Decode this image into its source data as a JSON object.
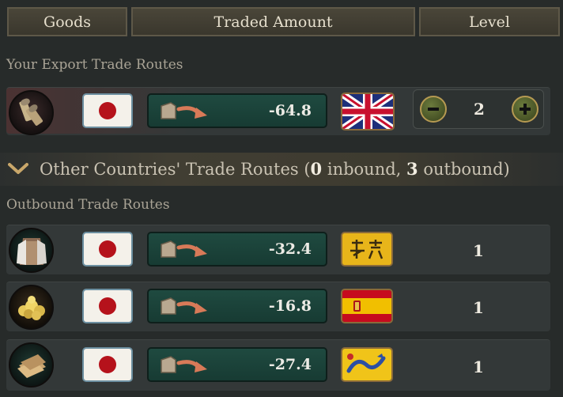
{
  "header": {
    "goods_label": "Goods",
    "traded_amount_label": "Traded Amount",
    "level_label": "Level"
  },
  "export_section": {
    "title": "Your Export Trade Routes",
    "routes": [
      {
        "good_icon": "ammunition-icon",
        "origin_flag": "japan-flag-icon",
        "amount": "-64.8",
        "partner_flag": "great-britain-flag-icon",
        "level": "2"
      }
    ]
  },
  "other_section": {
    "prefix": "Other Countries' Trade Routes (",
    "inbound_count": "0",
    "inbound_word": " inbound, ",
    "outbound_count": "3",
    "outbound_word": " outbound)"
  },
  "outbound_section": {
    "title": "Outbound Trade Routes",
    "routes": [
      {
        "good_icon": "clothes-icon",
        "origin_flag": "japan-flag-icon",
        "amount": "-32.4",
        "partner_flag": "yellow-banner-flag-icon",
        "level": "1"
      },
      {
        "good_icon": "gold-icon",
        "origin_flag": "japan-flag-icon",
        "amount": "-16.8",
        "partner_flag": "spain-flag-icon",
        "level": "1"
      },
      {
        "good_icon": "paper-icon",
        "origin_flag": "japan-flag-icon",
        "amount": "-27.4",
        "partner_flag": "qing-dragon-flag-icon",
        "level": "1"
      }
    ]
  }
}
